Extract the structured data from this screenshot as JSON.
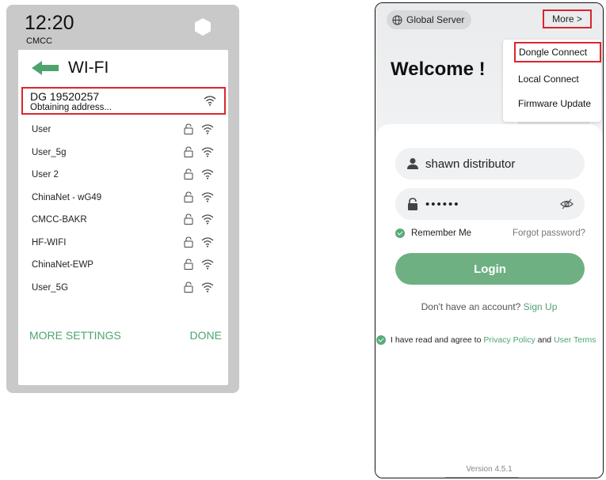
{
  "left_phone": {
    "status_time": "12:20",
    "carrier": "CMCC",
    "screen_title": "WI-FI",
    "selected_network": {
      "ssid": "DG 19520257",
      "status": "Obtaining address..."
    },
    "networks": [
      {
        "name": "User",
        "locked": true
      },
      {
        "name": "User_5g",
        "locked": true
      },
      {
        "name": "User 2",
        "locked": true
      },
      {
        "name": "ChinaNet - wG49",
        "locked": true
      },
      {
        "name": "CMCC-BAKR",
        "locked": true
      },
      {
        "name": "HF-WIFI",
        "locked": true
      },
      {
        "name": "ChinaNet-EWP",
        "locked": true
      },
      {
        "name": "User_5G",
        "locked": true
      }
    ],
    "more_settings_label": "MORE SETTINGS",
    "done_label": "DONE"
  },
  "right_phone": {
    "server_label": "Global Server",
    "more_label": "More >",
    "welcome": "Welcome !",
    "menu": [
      "Dongle Connect",
      "Local Connect",
      "Firmware Update"
    ],
    "username": "shawn distributor",
    "password_mask": "••••••",
    "remember_label": "Remember Me",
    "forgot_label": "Forgot password?",
    "login_label": "Login",
    "no_account_text": "Don't have an account?",
    "signup_label": "Sign Up",
    "agree_prefix": "I have read and agree to",
    "privacy_label": "Privacy Policy",
    "agree_and": "and",
    "terms_label": "User Terms",
    "version": "Version 4.5.1"
  },
  "colors": {
    "highlight_box": "#d9262b",
    "accent_green": "#4fa36f",
    "login_button": "#6fb083"
  },
  "icons": [
    "back-arrow-icon",
    "hexagon-icon",
    "wifi-icon",
    "lock-icon",
    "globe-icon",
    "user-icon",
    "padlock-icon",
    "eye-off-icon",
    "check-icon"
  ]
}
